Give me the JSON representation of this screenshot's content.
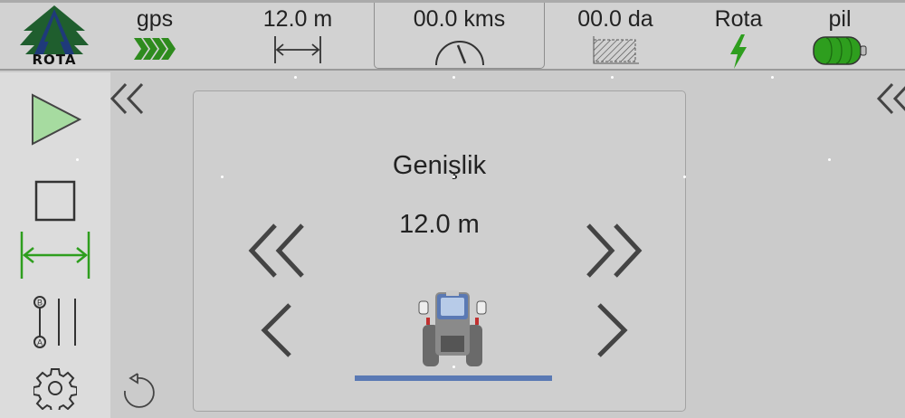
{
  "logo": {
    "text": "ROTA",
    "icon": "rota-logo-icon"
  },
  "status": {
    "gps": {
      "label": "gps",
      "icon": "gps-signal-arrows-icon",
      "color": "#2e8b1e"
    },
    "width": {
      "label": "12.0 m",
      "icon": "width-measure-icon"
    },
    "speed": {
      "label": "00.0 kms",
      "icon": "speedometer-icon"
    },
    "area": {
      "label": "00.0 da",
      "icon": "area-hatch-icon"
    },
    "route": {
      "label": "Rota",
      "icon": "lightning-icon",
      "color": "#2e9e1e"
    },
    "battery": {
      "label": "pil",
      "icon": "battery-icon",
      "color": "#2e9e1e"
    }
  },
  "sidebar": {
    "items": [
      {
        "name": "play",
        "icon": "play-icon",
        "color": "#a6dba0"
      },
      {
        "name": "stop",
        "icon": "stop-square-icon"
      },
      {
        "name": "width",
        "icon": "width-arrows-icon",
        "color": "#2e9e1e",
        "active": true
      },
      {
        "name": "ab-line",
        "icon": "ab-line-icon"
      },
      {
        "name": "settings",
        "icon": "gear-icon"
      }
    ]
  },
  "nav": {
    "left_collapse_icon": "double-chevron-left-icon",
    "right_collapse_icon": "double-chevron-left-icon",
    "undo_icon": "undo-icon"
  },
  "panel": {
    "title": "Genişlik",
    "value": "12.0 m",
    "controls": {
      "decrease_large_icon": "double-chevron-left-icon",
      "increase_large_icon": "double-chevron-right-icon",
      "decrease_small_icon": "chevron-left-icon",
      "increase_small_icon": "chevron-right-icon"
    },
    "tractor_icon": "tractor-icon",
    "implement_color": "#5a79b4"
  }
}
